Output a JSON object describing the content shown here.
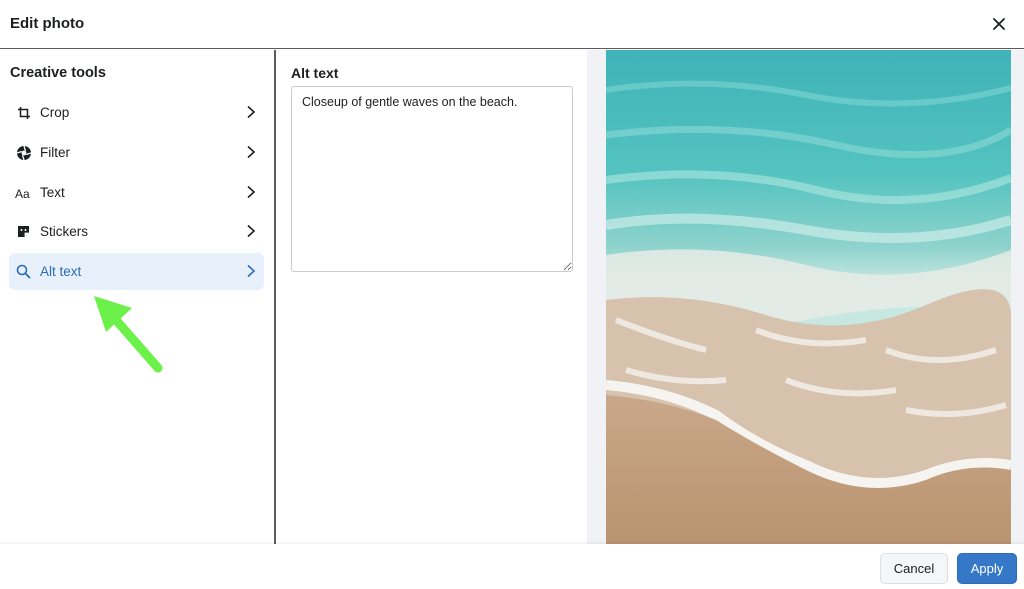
{
  "header": {
    "title": "Edit photo",
    "close_icon": "close-icon"
  },
  "sidebar": {
    "heading": "Creative tools",
    "items": [
      {
        "label": "Crop",
        "icon": "crop-icon",
        "active": false
      },
      {
        "label": "Filter",
        "icon": "filter-icon",
        "active": false
      },
      {
        "label": "Text",
        "icon": "text-icon",
        "active": false
      },
      {
        "label": "Stickers",
        "icon": "sticker-icon",
        "active": false
      },
      {
        "label": "Alt text",
        "icon": "search-icon",
        "active": true
      }
    ]
  },
  "alt_text": {
    "heading": "Alt text",
    "value": "Closeup of gentle waves on the beach."
  },
  "footer": {
    "cancel_label": "Cancel",
    "apply_label": "Apply"
  },
  "colors": {
    "accent": "#3578c8",
    "active_item_bg": "#e7f0fb",
    "active_item_text": "#2a6bb8",
    "annotation_arrow": "#6cf04a"
  }
}
